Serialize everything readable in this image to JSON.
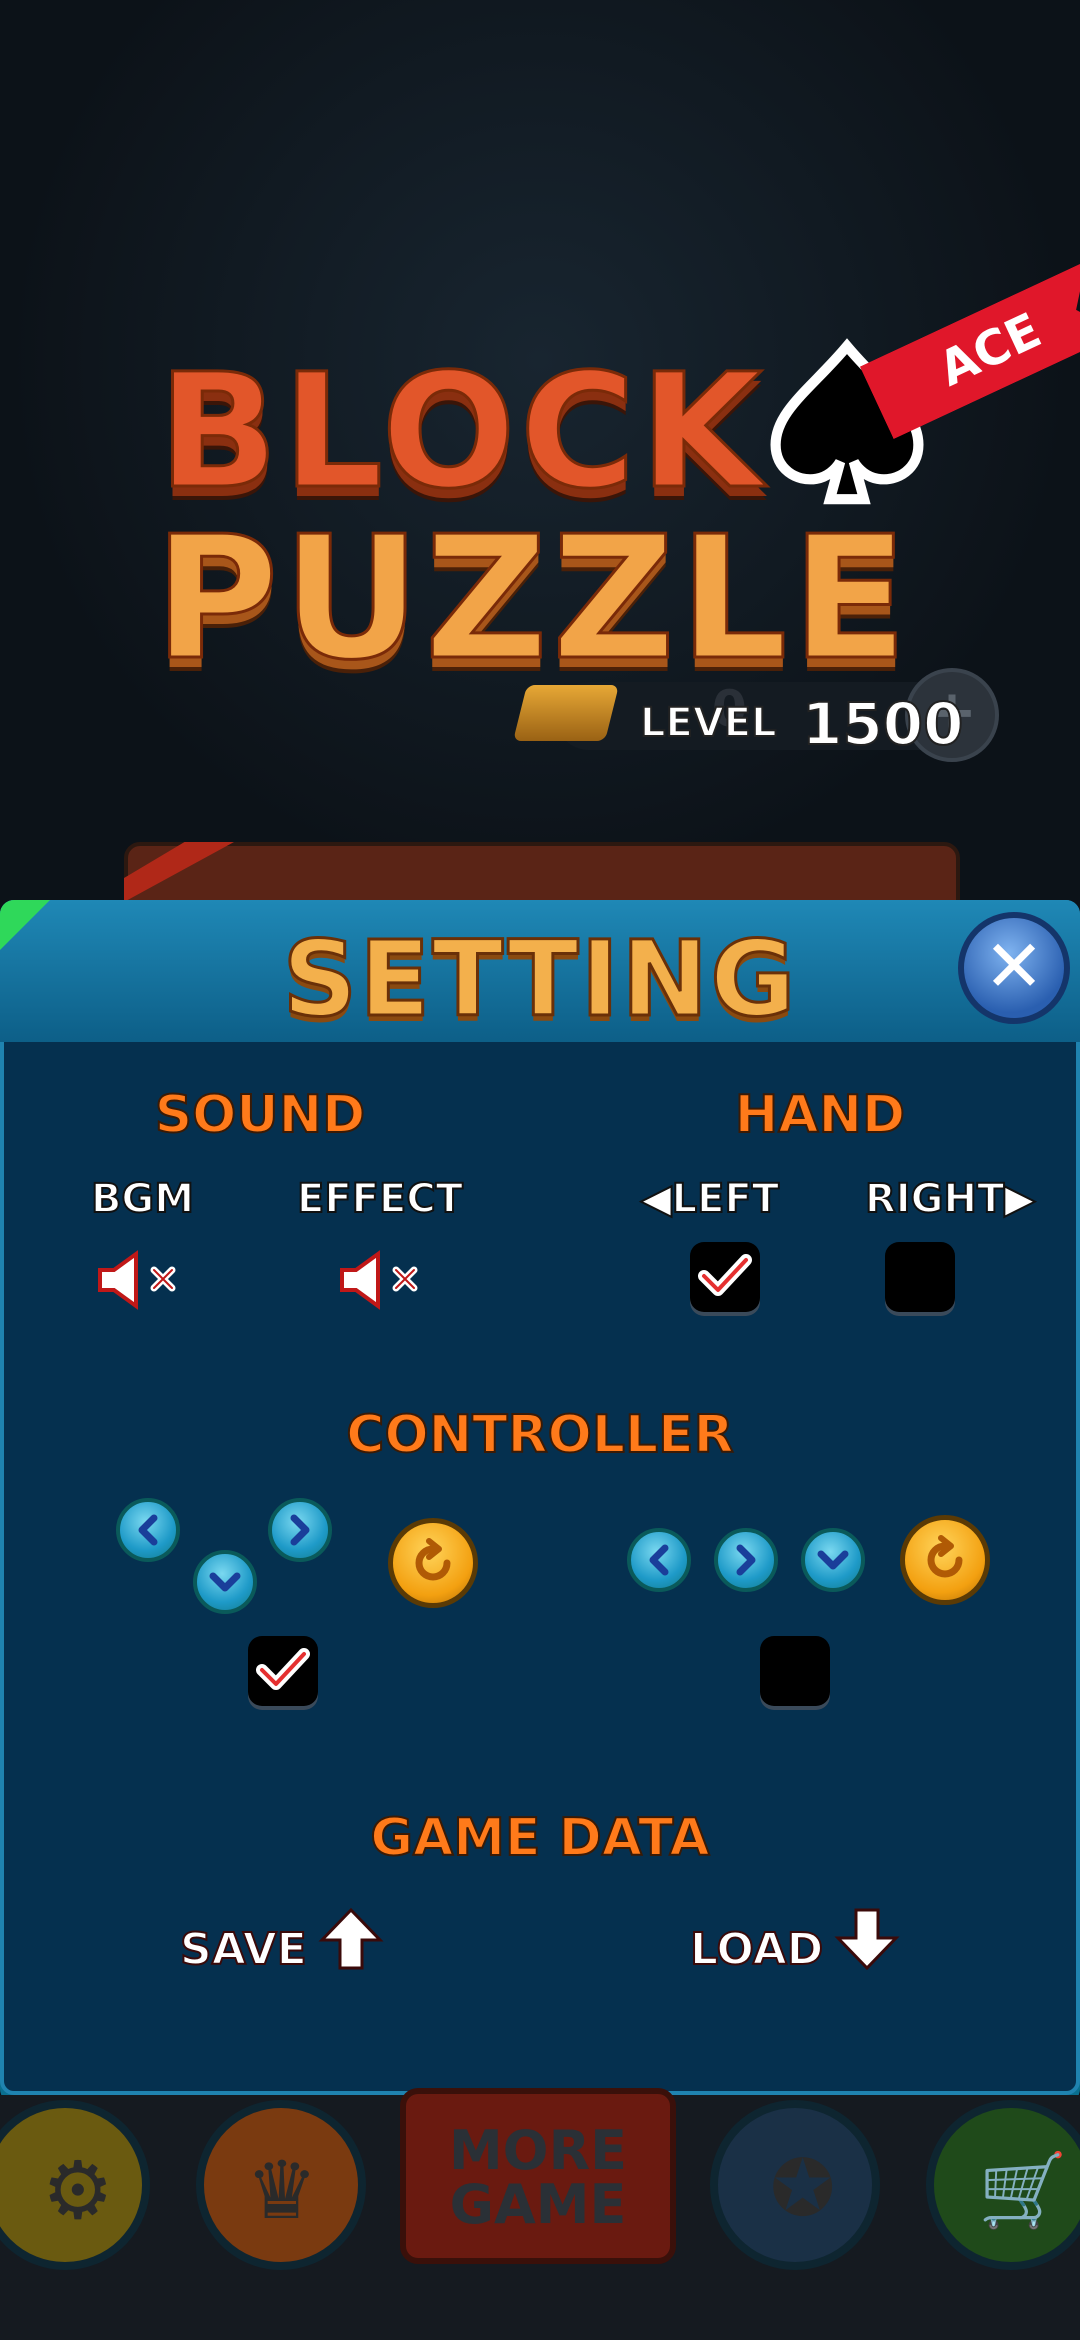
{
  "logo": {
    "line1": "BLOCK",
    "line2": "PUZZLE",
    "ribbon": "ACE"
  },
  "level": {
    "label": "LEVEL",
    "value": "1500",
    "coins": "0"
  },
  "setting": {
    "title": "SETTING",
    "sound": {
      "title": "SOUND",
      "bgm": "BGM",
      "effect": "EFFECT",
      "bgm_muted": true,
      "effect_muted": true
    },
    "hand": {
      "title": "HAND",
      "left": "LEFT",
      "right": "RIGHT",
      "left_checked": true,
      "right_checked": false
    },
    "controller": {
      "title": "CONTROLLER",
      "layout_a_checked": true,
      "layout_b_checked": false
    },
    "game_data": {
      "title": "GAME DATA",
      "save": "SAVE",
      "load": "LOAD"
    }
  },
  "bottom": {
    "more_game": "MORE GAME"
  },
  "colors": {
    "panel": "#05304f",
    "header": "#1f88b6",
    "accent": "#ff7a1a",
    "check": "#e53030"
  },
  "icons": [
    "spade-icon",
    "gold-bar-icon",
    "plus-icon",
    "close-icon",
    "mute-icon",
    "checkmark-icon",
    "arrow-left-icon",
    "arrow-right-icon",
    "arrow-down-icon",
    "rotate-icon",
    "upload-arrow-icon",
    "download-arrow-icon",
    "gear-icon",
    "crown-icon",
    "badge-icon",
    "cart-icon"
  ]
}
